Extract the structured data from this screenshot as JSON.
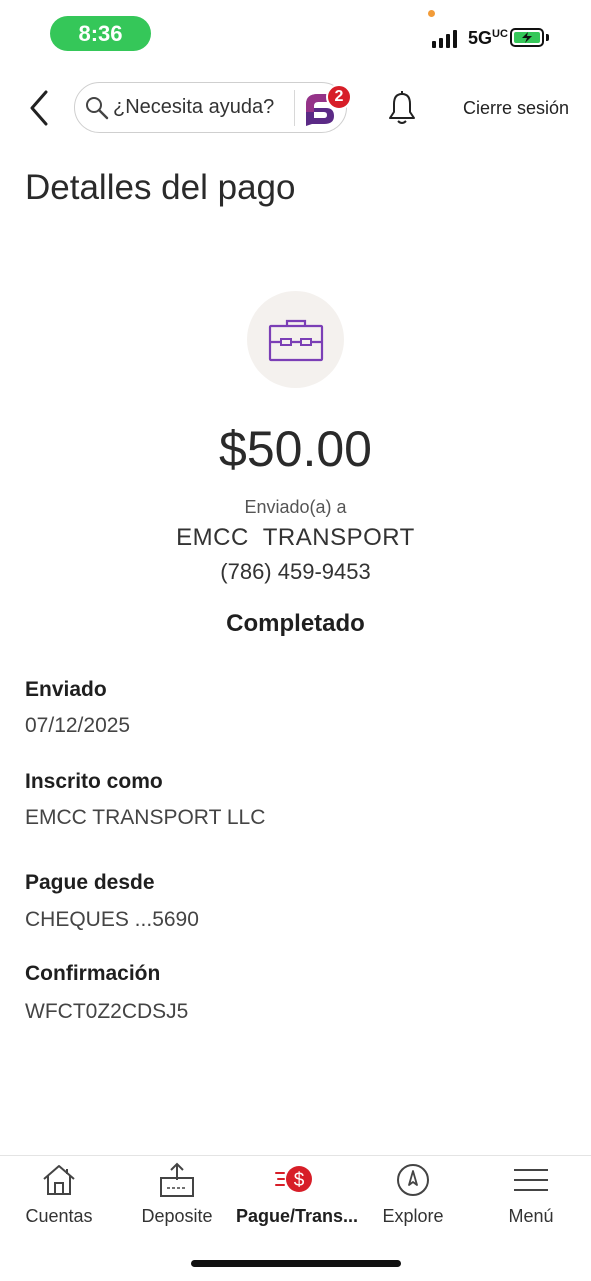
{
  "status_bar": {
    "time": "8:36",
    "network": "5GUC"
  },
  "header": {
    "search_placeholder": "¿Necesita ayuda?",
    "notification_count": "2",
    "logout_label": "Cierre sesión"
  },
  "page": {
    "title": "Detalles del pago"
  },
  "payment": {
    "amount": "$50.00",
    "sent_to_label": "Enviado(a) a",
    "payee": "EMCC  TRANSPORT",
    "phone": "(786) 459-9453",
    "status": "Completado"
  },
  "details": [
    {
      "label": "Enviado",
      "value": "07/12/2025"
    },
    {
      "label": "Inscrito como",
      "value": "EMCC TRANSPORT LLC"
    },
    {
      "label": "Pague desde",
      "value": "CHEQUES ...5690"
    },
    {
      "label": "Confirmación",
      "value": "WFCT0Z2CDSJ5"
    }
  ],
  "nav": {
    "items": [
      {
        "label": "Cuentas",
        "icon": "home-icon"
      },
      {
        "label": "Deposite",
        "icon": "deposit-icon"
      },
      {
        "label": "Pague/Trans...",
        "icon": "pay-transfer-icon"
      },
      {
        "label": "Explore",
        "icon": "compass-icon"
      },
      {
        "label": "Menú",
        "icon": "menu-icon"
      }
    ]
  },
  "colors": {
    "accent_purple": "#7b3fb6",
    "brand_red": "#d71e28",
    "status_green": "#35c759"
  }
}
